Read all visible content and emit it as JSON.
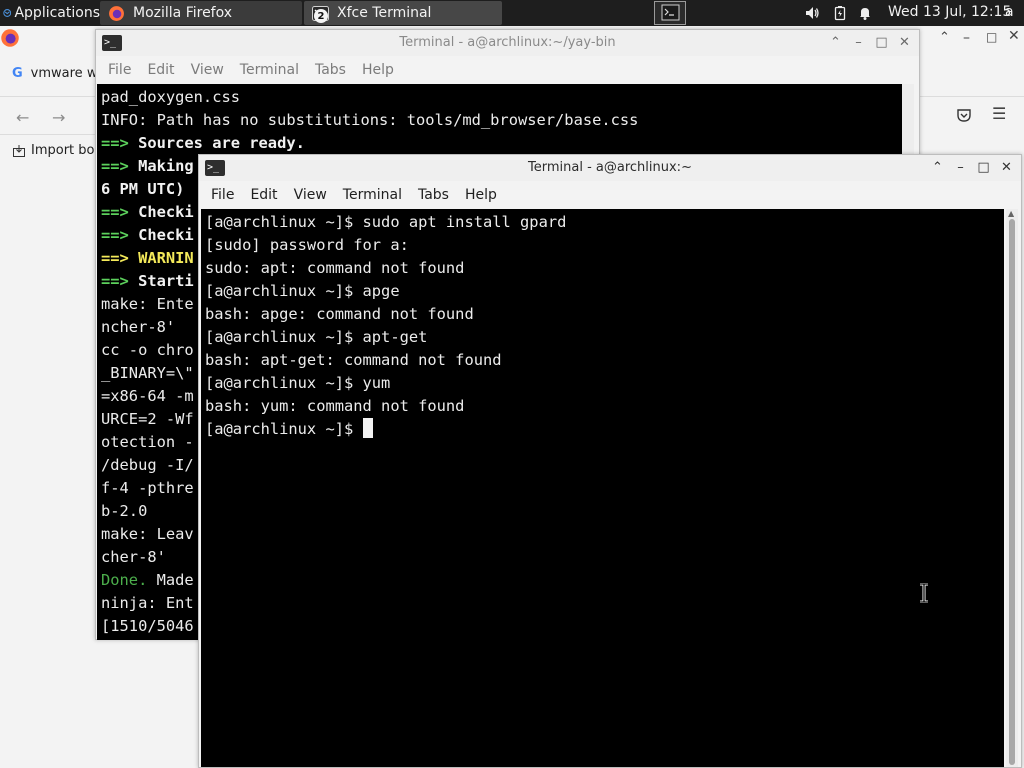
{
  "panel": {
    "applications_label": "Applications",
    "tasks": [
      {
        "label": "Mozilla Firefox",
        "icon": "firefox-icon"
      },
      {
        "label": "Xfce Terminal",
        "icon": "terminal-icon",
        "count": "2"
      }
    ],
    "clock": "Wed 13 Jul, 12:15",
    "user": "a"
  },
  "firefox": {
    "tab_title": "vmware w",
    "import_label": "Import bo"
  },
  "terminal_back": {
    "title": "Terminal - a@archlinux:~/yay-bin",
    "menu": [
      "File",
      "Edit",
      "View",
      "Terminal",
      "Tabs",
      "Help"
    ],
    "lines": [
      [
        {
          "t": "pad_doxygen.css",
          "s": ""
        }
      ],
      [
        {
          "t": "INFO: Path has no substitutions: tools/md_browser/base.css",
          "s": ""
        }
      ],
      [
        {
          "t": "==> ",
          "s": "g"
        },
        {
          "t": "Sources are ready.",
          "s": "b"
        }
      ],
      [
        {
          "t": "==> ",
          "s": "g"
        },
        {
          "t": "Making",
          "s": "b"
        }
      ],
      [
        {
          "t": "6 PM UTC)",
          "s": "b"
        }
      ],
      [
        {
          "t": "==> ",
          "s": "g"
        },
        {
          "t": "Checki",
          "s": "b"
        }
      ],
      [
        {
          "t": "==> ",
          "s": "g"
        },
        {
          "t": "Checki",
          "s": "b"
        }
      ],
      [
        {
          "t": "==> ",
          "s": "y"
        },
        {
          "t": "WARNIN",
          "s": "y"
        }
      ],
      [
        {
          "t": "==> ",
          "s": "g"
        },
        {
          "t": "Starti",
          "s": "b"
        }
      ],
      [
        {
          "t": "make: Ente",
          "s": ""
        }
      ],
      [
        {
          "t": "ncher-8'",
          "s": ""
        }
      ],
      [
        {
          "t": "cc -o chro",
          "s": ""
        }
      ],
      [
        {
          "t": "_BINARY=\\\"",
          "s": ""
        }
      ],
      [
        {
          "t": "=x86-64 -m",
          "s": ""
        }
      ],
      [
        {
          "t": "URCE=2 -Wf",
          "s": ""
        }
      ],
      [
        {
          "t": "otection -",
          "s": ""
        }
      ],
      [
        {
          "t": "/debug -I/",
          "s": ""
        }
      ],
      [
        {
          "t": "f-4 -pthre",
          "s": ""
        }
      ],
      [
        {
          "t": "b-2.0",
          "s": ""
        }
      ],
      [
        {
          "t": "make: Leav",
          "s": ""
        }
      ],
      [
        {
          "t": "cher-8'",
          "s": ""
        }
      ],
      [
        {
          "t": "Done. ",
          "s": "gd"
        },
        {
          "t": "Made",
          "s": ""
        }
      ],
      [
        {
          "t": "ninja: Ent",
          "s": ""
        }
      ],
      [
        {
          "t": "[1510/5046",
          "s": ""
        }
      ]
    ]
  },
  "terminal_front": {
    "title": "Terminal - a@archlinux:~",
    "menu": [
      "File",
      "Edit",
      "View",
      "Terminal",
      "Tabs",
      "Help"
    ],
    "lines": [
      "[a@archlinux ~]$ sudo apt install gpard",
      "[sudo] password for a:",
      "sudo: apt: command not found",
      "[a@archlinux ~]$ apge",
      "bash: apge: command not found",
      "[a@archlinux ~]$ apt-get",
      "bash: apt-get: command not found",
      "[a@archlinux ~]$ yum",
      "bash: yum: command not found"
    ],
    "prompt": "[a@archlinux ~]$ "
  }
}
